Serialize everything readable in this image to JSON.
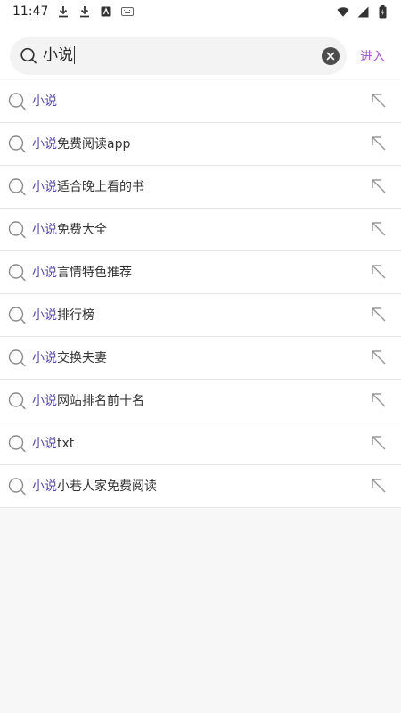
{
  "status_bar": {
    "time": "11:47",
    "icons": [
      "download-icon",
      "download-icon",
      "app-badge-icon",
      "keyboard-icon",
      "wifi-icon",
      "signal-icon",
      "battery-charging-icon"
    ]
  },
  "search": {
    "query": "小说",
    "enter_label": "进入"
  },
  "suggestions": [
    {
      "highlight": "小说",
      "rest": ""
    },
    {
      "highlight": "小说",
      "rest": "免费阅读app"
    },
    {
      "highlight": "小说",
      "rest": "适合晚上看的书"
    },
    {
      "highlight": "小说",
      "rest": "免费大全"
    },
    {
      "highlight": "小说",
      "rest": "言情特色推荐"
    },
    {
      "highlight": "小说",
      "rest": "排行榜"
    },
    {
      "highlight": "小说",
      "rest": "交换夫妻"
    },
    {
      "highlight": "小说",
      "rest": "网站排名前十名"
    },
    {
      "highlight": "小说",
      "rest": "txt"
    },
    {
      "highlight": "小说",
      "rest": "小巷人家免费阅读"
    }
  ],
  "colors": {
    "highlight": "#5b48b8",
    "enter_button": "#a85ad8",
    "background": "#f7f7f7"
  }
}
